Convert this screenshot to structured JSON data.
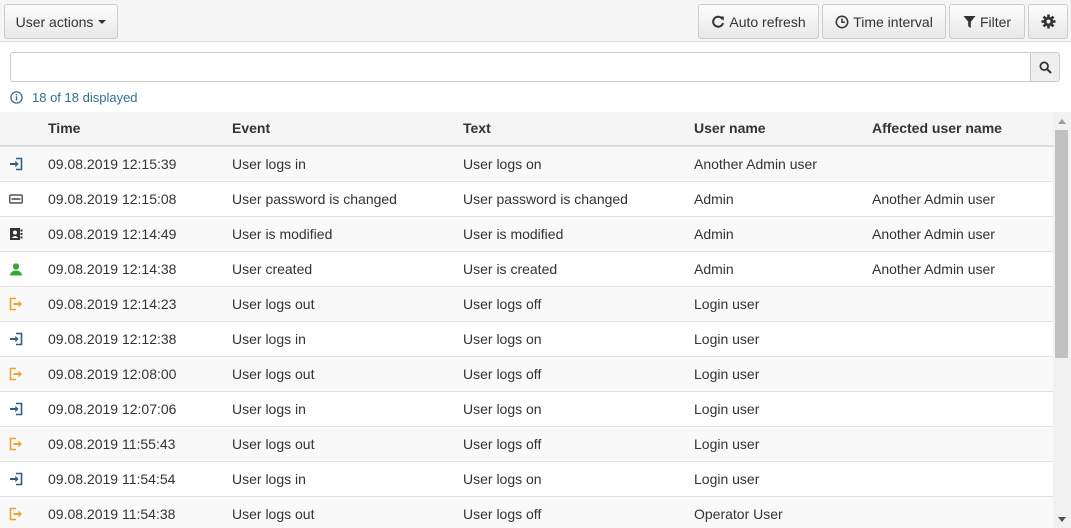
{
  "toolbar": {
    "user_actions_label": "User actions",
    "auto_refresh_label": "Auto refresh",
    "time_interval_label": "Time interval",
    "filter_label": "Filter"
  },
  "search": {
    "value": "",
    "placeholder": ""
  },
  "status": {
    "displayed_text": "18 of 18 displayed",
    "color": "#31708f"
  },
  "table": {
    "columns": [
      "Time",
      "Event",
      "Text",
      "User name",
      "Affected user name"
    ],
    "rows": [
      {
        "icon": "login-icon",
        "time": "09.08.2019 12:15:39",
        "event": "User logs in",
        "text": "User logs on",
        "user": "Another Admin user",
        "affected": ""
      },
      {
        "icon": "password-icon",
        "time": "09.08.2019 12:15:08",
        "event": "User password is changed",
        "text": "User password is changed",
        "user": "Admin",
        "affected": "Another Admin user"
      },
      {
        "icon": "user-edit-icon",
        "time": "09.08.2019 12:14:49",
        "event": "User is modified",
        "text": "User is modified",
        "user": "Admin",
        "affected": "Another Admin user"
      },
      {
        "icon": "user-created-icon",
        "time": "09.08.2019 12:14:38",
        "event": "User created",
        "text": "User is created",
        "user": "Admin",
        "affected": "Another Admin user"
      },
      {
        "icon": "logout-icon",
        "time": "09.08.2019 12:14:23",
        "event": "User logs out",
        "text": "User logs off",
        "user": "Login user",
        "affected": ""
      },
      {
        "icon": "login-icon",
        "time": "09.08.2019 12:12:38",
        "event": "User logs in",
        "text": "User logs on",
        "user": "Login user",
        "affected": ""
      },
      {
        "icon": "logout-icon",
        "time": "09.08.2019 12:08:00",
        "event": "User logs out",
        "text": "User logs off",
        "user": "Login user",
        "affected": ""
      },
      {
        "icon": "login-icon",
        "time": "09.08.2019 12:07:06",
        "event": "User logs in",
        "text": "User logs on",
        "user": "Login user",
        "affected": ""
      },
      {
        "icon": "logout-icon",
        "time": "09.08.2019 11:55:43",
        "event": "User logs out",
        "text": "User logs off",
        "user": "Login user",
        "affected": ""
      },
      {
        "icon": "login-icon",
        "time": "09.08.2019 11:54:54",
        "event": "User logs in",
        "text": "User logs on",
        "user": "Login user",
        "affected": ""
      },
      {
        "icon": "logout-icon",
        "time": "09.08.2019 11:54:38",
        "event": "User logs out",
        "text": "User logs off",
        "user": "Operator User",
        "affected": ""
      }
    ]
  },
  "colors": {
    "login": "#2b5f8a",
    "logout": "#f0a030",
    "user_created": "#3aa33a",
    "neutral_icon": "#333333"
  }
}
